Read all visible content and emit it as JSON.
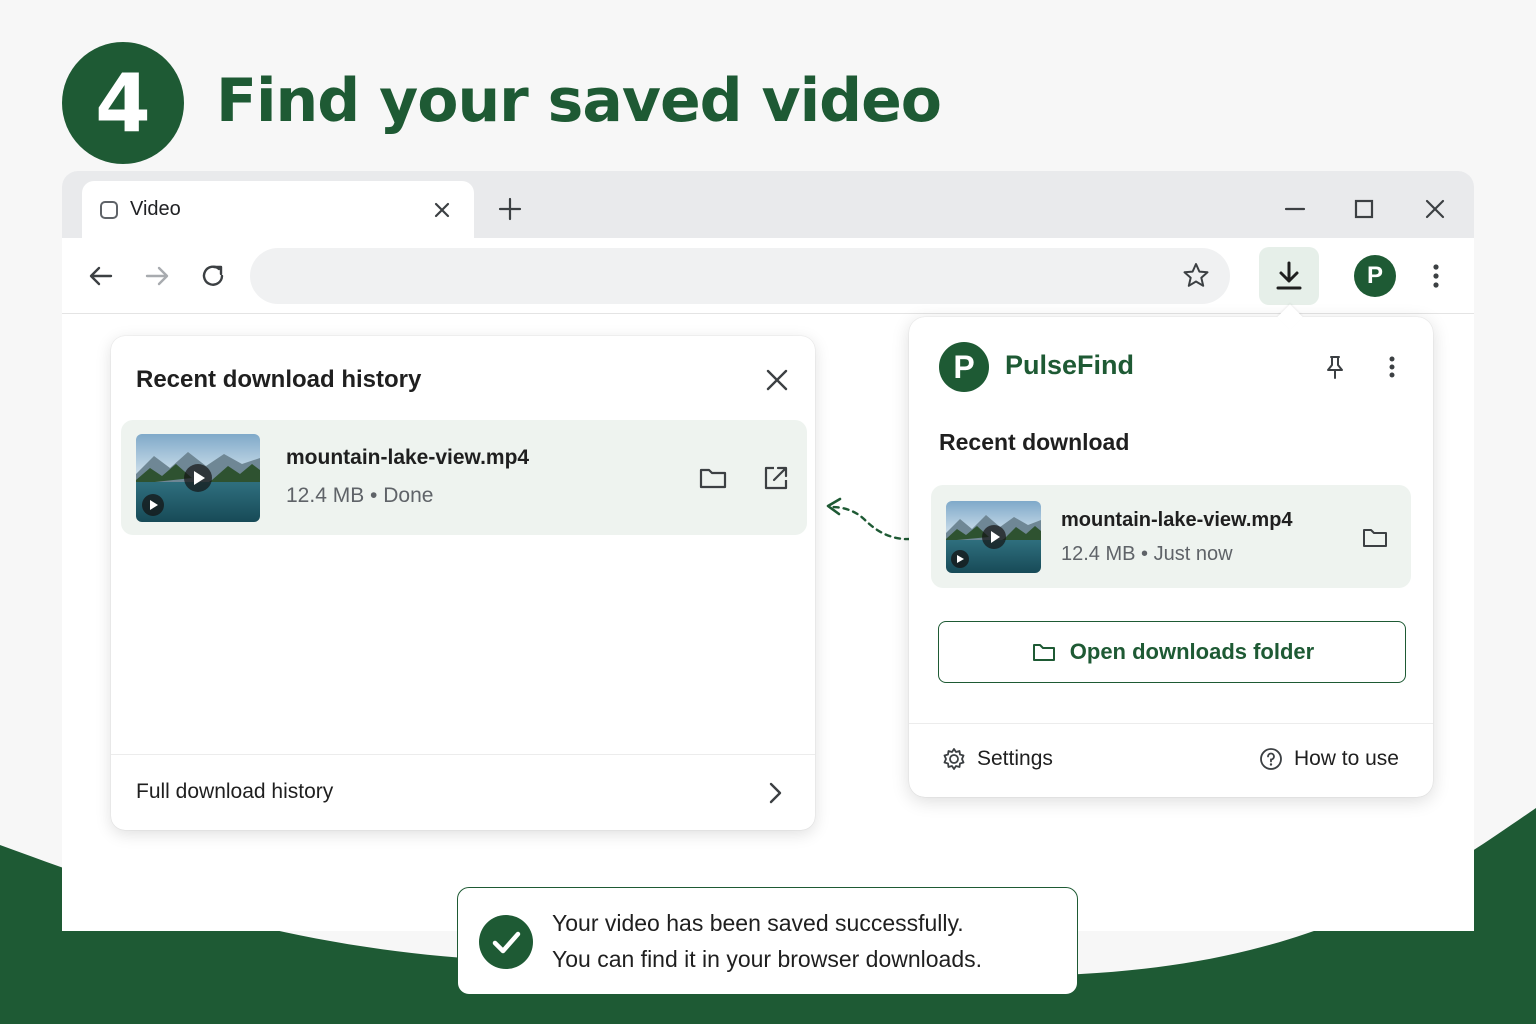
{
  "step": {
    "number": "4",
    "title": "Find your saved video"
  },
  "browser": {
    "tab_label": "Video",
    "address_value": ""
  },
  "history_panel": {
    "title": "Recent download history",
    "item": {
      "filename": "mountain-lake-view.mp4",
      "meta": "12.4 MB • Done"
    },
    "footer_label": "Full download history"
  },
  "popup": {
    "avatar_letter": "P",
    "logo_letter": "P",
    "brand_name": "PulseFind",
    "section_title": "Recent download",
    "item": {
      "filename": "mountain-lake-view.mp4",
      "meta": "12.4 MB • Just now"
    },
    "open_folder_label": "Open downloads folder",
    "settings_label": "Settings",
    "how_to_label": "How to use"
  },
  "toast": {
    "line1": "Your video has been saved successfully.",
    "line2": "You can find it in your browser downloads."
  },
  "icons": {
    "tab": "page-icon",
    "tab_close": "close-icon",
    "new_tab": "plus-icon",
    "minimize": "minimize-icon",
    "maximize": "maximize-icon",
    "close_window": "close-icon",
    "back": "arrow-left-icon",
    "forward": "arrow-right-icon",
    "reload": "reload-icon",
    "bookmark": "star-icon",
    "downloads": "download-icon",
    "menu": "kebab-icon",
    "folder": "folder-icon",
    "open_external": "external-link-icon",
    "chevron": "chevron-right-icon",
    "pin": "pin-icon",
    "settings": "gear-icon",
    "help": "help-circle-icon",
    "success": "check-icon"
  },
  "colors": {
    "brand_green": "#1e5a34",
    "item_bg": "#eef3ef",
    "download_button_bg": "#e6efe9"
  }
}
